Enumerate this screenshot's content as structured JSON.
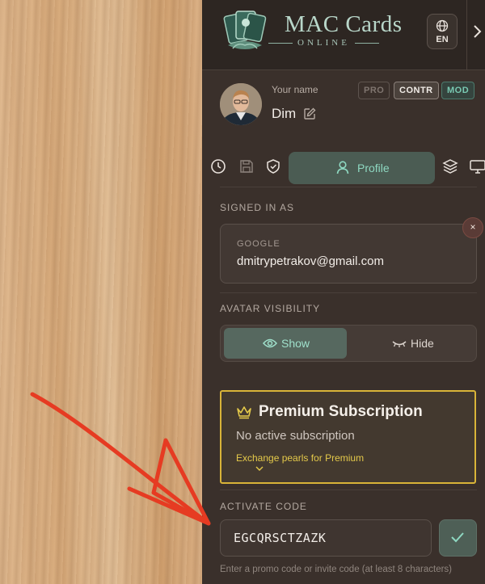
{
  "app": {
    "title": "MAC Cards",
    "subtitle": "ONLINE",
    "language": "EN"
  },
  "user": {
    "your_name_label": "Your name",
    "name": "Dim",
    "badges": [
      "PRO",
      "CONTR",
      "MOD"
    ]
  },
  "tabs": {
    "icons": [
      "history-icon",
      "save-icon",
      "shield-icon",
      "layers-icon",
      "monitor-icon"
    ],
    "active_label": "Profile"
  },
  "signed_in": {
    "section_title": "SIGNED IN AS",
    "provider": "GOOGLE",
    "email": "dmitrypetrakov@gmail.com",
    "close": "×"
  },
  "avatar_visibility": {
    "section_title": "AVATAR VISIBILITY",
    "show_label": "Show",
    "hide_label": "Hide",
    "selected": "Show"
  },
  "premium": {
    "title": "Premium Subscription",
    "status": "No active subscription",
    "link": "Exchange pearls for Premium"
  },
  "activate": {
    "section_title": "ACTIVATE CODE",
    "code_value": "EGCQRSCTZAZK",
    "hint": "Enter a promo code or invite code (at least 8 characters)"
  },
  "colors": {
    "accent": "#8ed8c1",
    "premium_border": "#d9b438",
    "arrow": "#e63b22"
  }
}
